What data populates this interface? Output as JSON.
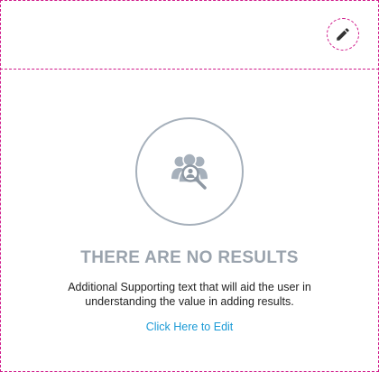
{
  "header": {
    "edit_icon": "pencil-icon",
    "edit_button_color": "#d0198a"
  },
  "empty_state": {
    "icon": "user-search-icon",
    "title": "THERE ARE NO RESULTS",
    "supporting_text": "Additional Supporting text that will aid the user in understanding the value in adding results.",
    "link_label": "Click Here to Edit",
    "link_color": "#1a9ad6",
    "title_color": "#9aa3ad"
  }
}
